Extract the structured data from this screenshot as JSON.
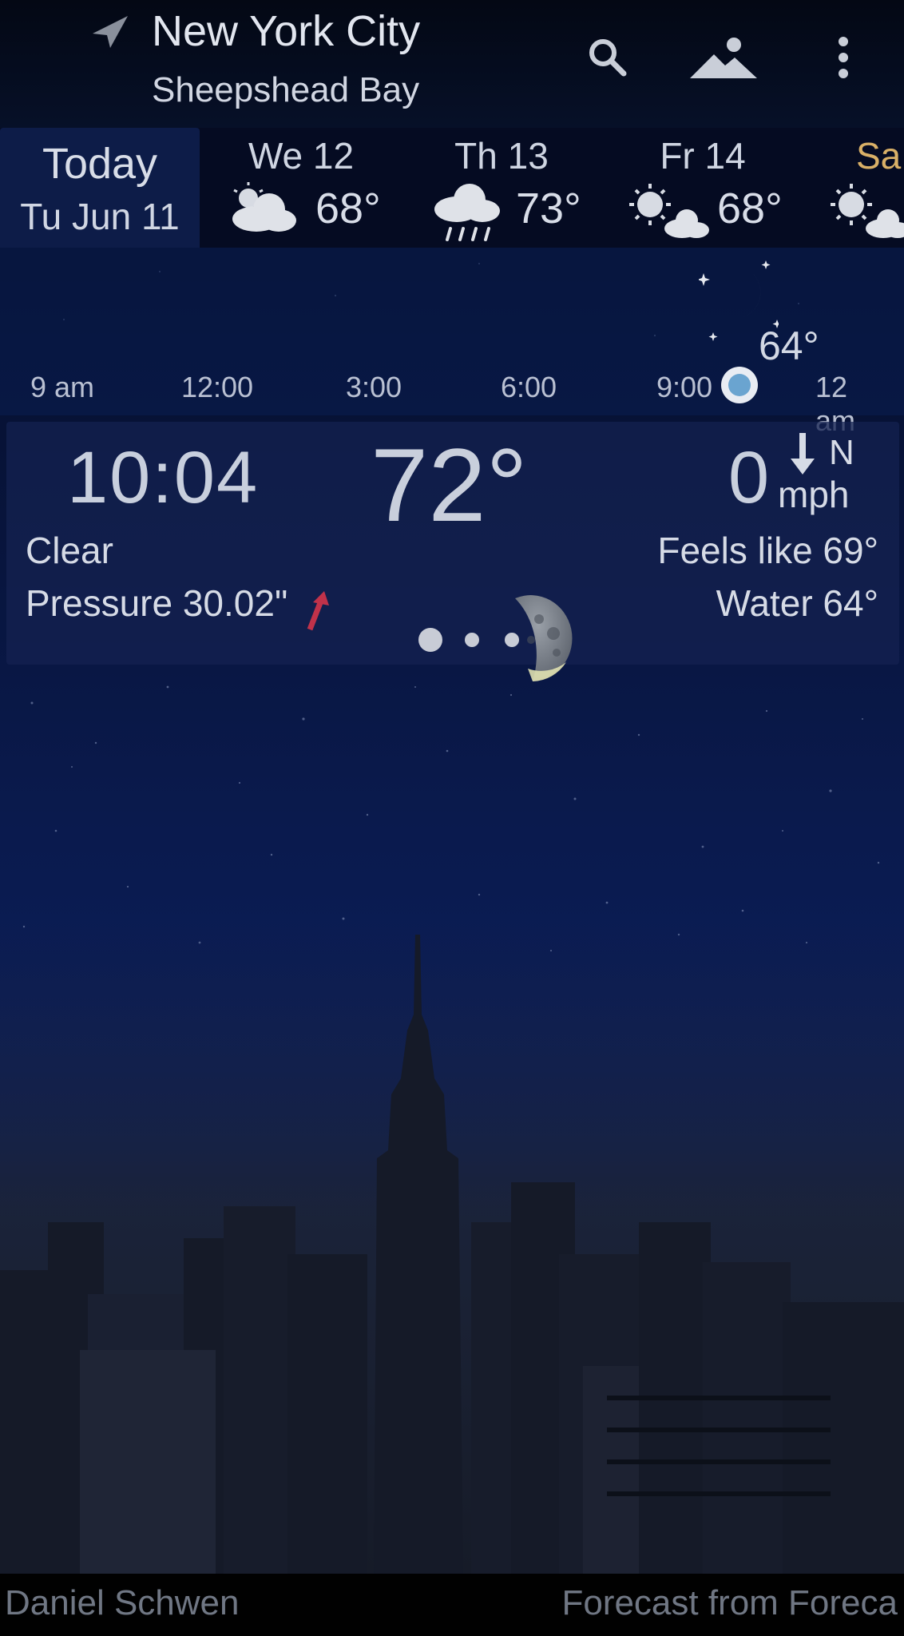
{
  "header": {
    "city": "New York City",
    "neighborhood": "Sheepshead Bay",
    "icons": [
      "location-arrow-icon",
      "search-icon",
      "landscape-icon",
      "more-vert-icon"
    ]
  },
  "days": {
    "today_label": "Today",
    "today_date": "Tu Jun 11",
    "forecast": [
      {
        "label": "We 12",
        "temp": "68°",
        "icon": "partly-cloudy-icon"
      },
      {
        "label": "Th 13",
        "temp": "73°",
        "icon": "rain-cloud-icon"
      },
      {
        "label": "Fr 14",
        "temp": "68°",
        "icon": "sun-cloud-icon"
      },
      {
        "label": "Sa",
        "temp": "",
        "icon": "sun-cloud-icon"
      }
    ]
  },
  "hourly": {
    "hours": [
      "9 am",
      "12:00",
      "3:00",
      "6:00",
      "9:00",
      "12 am"
    ],
    "temp": "64°",
    "icon": "moon-stars-icon"
  },
  "current": {
    "time": "10:04",
    "temperature": "72°",
    "wind_speed": "0",
    "wind_direction": "N",
    "wind_unit": "mph",
    "condition": "Clear",
    "feels_like": "Feels like 69°",
    "pressure": "Pressure 30.02\"",
    "water": "Water 64°"
  },
  "footer": {
    "photo_credit": "Daniel Schwen",
    "source": "Forecast from Foreca"
  },
  "colors": {
    "pressure_trend": "#c0324a",
    "saturday_label": "#d9b067",
    "current_hour_marker": "#6aa4d0"
  }
}
